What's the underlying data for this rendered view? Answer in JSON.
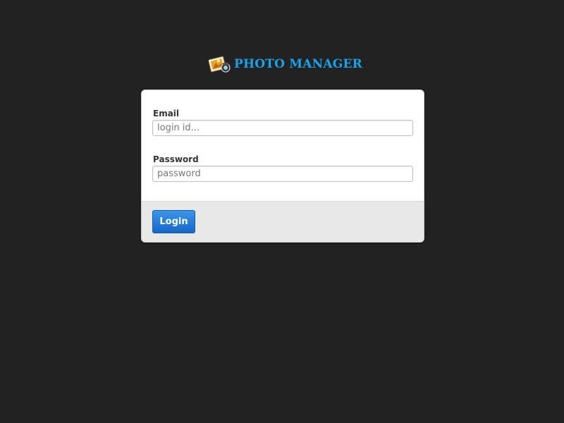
{
  "app": {
    "logo_text": "PHOTO MANAGER",
    "logo_icon": "photo-icon",
    "brand_color": "#1aa3e8"
  },
  "login_form": {
    "email_label": "Email",
    "email_placeholder": "login id...",
    "email_value": "",
    "password_label": "Password",
    "password_placeholder": "password",
    "password_value": "",
    "submit_label": "Login",
    "button_color": "#1a73d0"
  },
  "theme": {
    "background": "#222222",
    "card_background": "#ffffff",
    "footer_background": "#e8e8e8"
  }
}
